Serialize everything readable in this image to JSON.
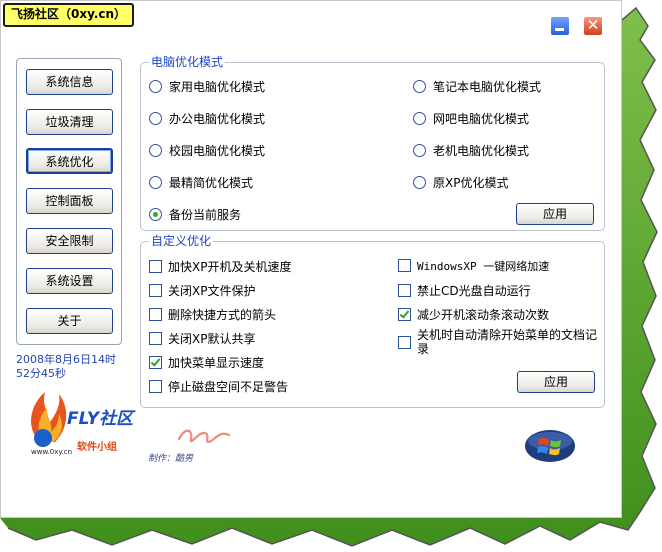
{
  "window": {
    "title": "飞扬社区（0xy.cn）"
  },
  "nav": {
    "items": [
      {
        "label": "系统信息",
        "active": false
      },
      {
        "label": "垃圾清理",
        "active": false
      },
      {
        "label": "系统优化",
        "active": true
      },
      {
        "label": "控制面板",
        "active": false
      },
      {
        "label": "安全限制",
        "active": false
      },
      {
        "label": "系统设置",
        "active": false
      },
      {
        "label": "关于",
        "active": false
      }
    ]
  },
  "clock": {
    "line1": "2008年8月6日14时",
    "line2": "52分45秒"
  },
  "mode_group": {
    "title": "电脑优化模式",
    "options": [
      {
        "label": "家用电脑优化模式",
        "selected": false
      },
      {
        "label": "笔记本电脑优化模式",
        "selected": false
      },
      {
        "label": "办公电脑优化模式",
        "selected": false
      },
      {
        "label": "网吧电脑优化模式",
        "selected": false
      },
      {
        "label": "校园电脑优化模式",
        "selected": false
      },
      {
        "label": "老机电脑优化模式",
        "selected": false
      },
      {
        "label": "最精简优化模式",
        "selected": false
      },
      {
        "label": "原XP优化模式",
        "selected": false
      },
      {
        "label": "备份当前服务",
        "selected": true
      }
    ],
    "apply_label": "应用"
  },
  "custom_group": {
    "title": "自定义优化",
    "options": [
      {
        "label": "加快XP开机及关机速度",
        "checked": false
      },
      {
        "label": "WindowsXP 一键网络加速",
        "checked": false
      },
      {
        "label": "关闭XP文件保护",
        "checked": false
      },
      {
        "label": "禁止CD光盘自动运行",
        "checked": false
      },
      {
        "label": "删除快捷方式的箭头",
        "checked": false
      },
      {
        "label": "减少开机滚动条滚动次数",
        "checked": true
      },
      {
        "label": "关闭XP默认共享",
        "checked": false
      },
      {
        "label": "关机时自动清除开始菜单的文档记录",
        "checked": false
      },
      {
        "label": "加快菜单显示速度",
        "checked": true
      },
      {
        "label": "停止磁盘空间不足警告",
        "checked": false
      }
    ],
    "apply_label": "应用"
  },
  "branding": {
    "logo_name": "FLY社区",
    "logo_url": "www.0xy.cn",
    "logo_sub": "软件小组",
    "credit": "制作：酷男"
  },
  "colors": {
    "group_title": "#1f44c8",
    "title_tag_bg": "#ffff66",
    "clock_text": "#2245b0"
  }
}
